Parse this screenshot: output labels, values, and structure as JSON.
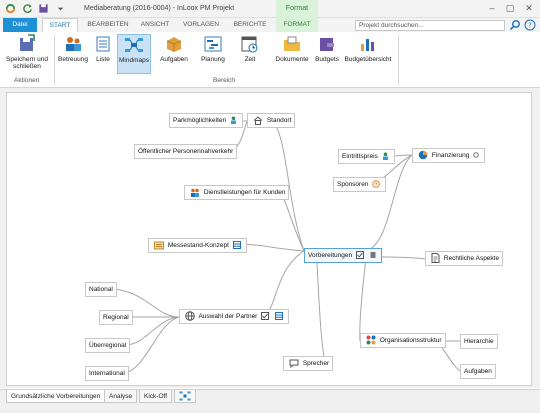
{
  "window": {
    "title": "Mediaberatung (2016-0004) - InLoox PM Projekt",
    "context_group": "Format",
    "minimize": "–",
    "maximize": "▢",
    "close": "✕"
  },
  "tabs": {
    "file": "Datei",
    "start": "START",
    "bearbeiten": "BEARBEITEN",
    "ansicht": "ANSICHT",
    "vorlagen": "VORLAGEN",
    "berichte": "BERICHTE",
    "format": "FORMAT"
  },
  "search": {
    "placeholder": "Projekt durchsuchen..."
  },
  "ribbon": {
    "save_close": "Speichern und schließen",
    "group_actions": "Aktionen",
    "betreuung": "Betreuung",
    "liste": "Liste",
    "mindmaps": "Mindmaps",
    "aufgaben": "Aufgaben",
    "planung": "Planung",
    "zeit": "Zeit",
    "dokumente": "Dokumente",
    "budgets": "Budgets",
    "budgetuebersicht": "Budgetübersicht",
    "group_bereich": "Bereich"
  },
  "mindmap": {
    "root": "Vorbereitungen",
    "standort": "Standort",
    "parkmoeglichkeiten": "Parkmöglichkeiten",
    "oepnv": "Öffentlicher Personennahverkehr",
    "dienstleistungen": "Dienstleistungen für Kunden",
    "messestand": "Messestand-Konzept",
    "partner": "Auswahl der Partner",
    "national": "National",
    "regional": "Regional",
    "ueberregional": "Überregional",
    "international": "International",
    "sprecher": "Sprecher",
    "finanzierung": "Finanzierung",
    "eintrittspreis": "Eintrittspreis",
    "sponsoren": "Sponsoren",
    "rechtliche": "Rechtliche Aspekte",
    "organisation": "Organisationsstruktur",
    "hierarchie": "Hierarchie",
    "aufgaben": "Aufgaben"
  },
  "bottom_tabs": {
    "grundsaetzliche": "Grundsätzliche Vorbereitungen",
    "analyse": "Analyse",
    "kickoff": "Kick-Off"
  },
  "colors": {
    "accent": "#1e90d6",
    "format_green": "#d9f2d9",
    "selected": "#c9e2f5",
    "link": "#9a9a9a"
  }
}
